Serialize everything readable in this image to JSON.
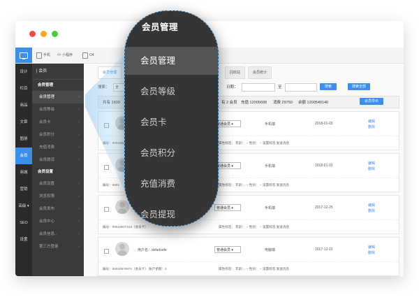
{
  "window": {
    "devices": [
      {
        "label": "手机"
      },
      {
        "label": "小程序"
      },
      {
        "label": "O4"
      }
    ]
  },
  "left_nav": [
    {
      "label": "设计"
    },
    {
      "label": "栏目"
    },
    {
      "label": "商品"
    },
    {
      "label": "文章"
    },
    {
      "label": "图册"
    },
    {
      "label": "会员",
      "active": true
    },
    {
      "label": "商城"
    },
    {
      "label": "营销"
    },
    {
      "label": "高级 ▾"
    },
    {
      "label": "SEO"
    },
    {
      "label": "设置"
    }
  ],
  "sub_nav": {
    "header": "| 会员",
    "groups": [
      {
        "title": "会员管理",
        "items": [
          "会员管理",
          "会员等级",
          "会员卡",
          "会员积分",
          "充值消费",
          "会员提现"
        ]
      },
      {
        "title": "会员设置",
        "items": [
          "会员设置",
          "浏览权限",
          "会员发布",
          "会员中心",
          "会员信息..",
          "第三方登录"
        ]
      }
    ]
  },
  "tabs": [
    {
      "label": "会员管理",
      "active": true
    },
    {
      "label": "回收站"
    },
    {
      "label": "会员统计"
    }
  ],
  "filter": {
    "search_label": "搜索：",
    "search_value": "全",
    "date_label": "日期：",
    "to_label": "至",
    "search_button": "搜索",
    "search_all_button": "搜索全部"
  },
  "stats": {
    "total": "共有 1609",
    "parts": [
      "有 2 会员",
      "充值 12005698",
      "消费 29750",
      "余额 1200540146"
    ],
    "export_button": "会员导出"
  },
  "members": [
    {
      "username": "",
      "level": "普通会员 ▾",
      "platform": "手机端",
      "date": "2018-01-03",
      "actions": [
        "编辑",
        "删除"
      ],
      "footer_id": "编号：0001052",
      "footer_attrs": "属性标签： 年龄： -- 性别： -- 设置标签 发送消息"
    },
    {
      "username": "",
      "level": "普通会员 ▾",
      "platform": "手机端",
      "date": "2018-01-03",
      "actions": [
        "编辑",
        "删除"
      ],
      "footer_id": "编号：0001",
      "footer_attrs": "属性标签： 年龄： -- 性别： -- 设置标签 发送消息"
    },
    {
      "username": "",
      "level": "普通会员 ▾",
      "platform": "手机端",
      "date": "2017-12-25",
      "actions": [
        "编辑",
        "删除"
      ],
      "footer_id": "编号：00010627314（会员卡）",
      "footer_attrs": "属性标签： 年龄： -- 性别： -- 设置标签 发送消息"
    },
    {
      "username": "用户名：dsfadsafe",
      "level": "普通会员 ▾",
      "platform": "电脑端",
      "date": "2017-12-22",
      "actions": [
        "编辑",
        "删除"
      ],
      "footer_id": "编号：00010570674（会员卡） 账户余额：0",
      "footer_attrs": "属性标签： 年龄： -- 性别： -- 设置标签 发送消息"
    }
  ],
  "zoom_menu": {
    "title": "会员管理",
    "items": [
      {
        "label": "会员管理",
        "active": true
      },
      {
        "label": "会员等级"
      },
      {
        "label": "会员卡"
      },
      {
        "label": "会员积分"
      },
      {
        "label": "充值消费"
      },
      {
        "label": "会员提现"
      }
    ]
  }
}
